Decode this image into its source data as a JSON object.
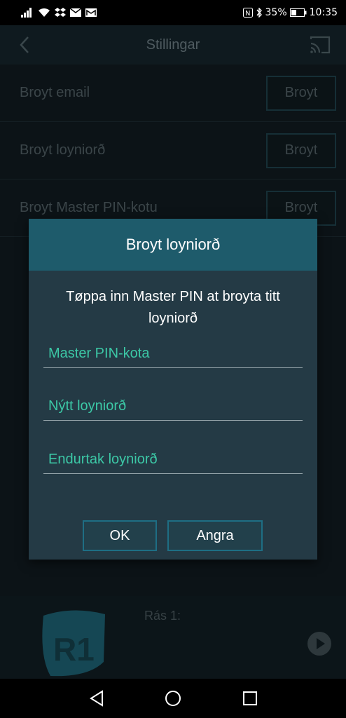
{
  "status_bar": {
    "battery": "35%",
    "time": "10:35"
  },
  "topbar": {
    "title": "Stillingar"
  },
  "settings": [
    {
      "label": "Broyt email",
      "button": "Broyt"
    },
    {
      "label": "Broyt loyniorð",
      "button": "Broyt"
    },
    {
      "label": "Broyt Master PIN-kotu",
      "button": "Broyt"
    }
  ],
  "player": {
    "channel": "Rás 1:",
    "logo_text": "R1"
  },
  "dialog": {
    "title": "Broyt loyniorð",
    "message": "Tøppa inn Master PIN at broyta titt loyniorð",
    "fields": {
      "master_pin_placeholder": "Master PIN-kota",
      "new_password_placeholder": "Nýtt loyniorð",
      "repeat_password_placeholder": "Endurtak loyniorð"
    },
    "ok_label": "OK",
    "cancel_label": "Angra"
  },
  "icons": {
    "back": "chevron-left-icon",
    "cast": "cast-icon",
    "play": "play-circle-icon",
    "nav_back": "triangle-back-icon",
    "nav_home": "circle-home-icon",
    "nav_recents": "square-recents-icon"
  },
  "colors": {
    "accent": "#3cc8a6",
    "dialog_header": "#1e5b6b",
    "dialog_body": "#243a45",
    "button_border": "#1e6e84"
  }
}
